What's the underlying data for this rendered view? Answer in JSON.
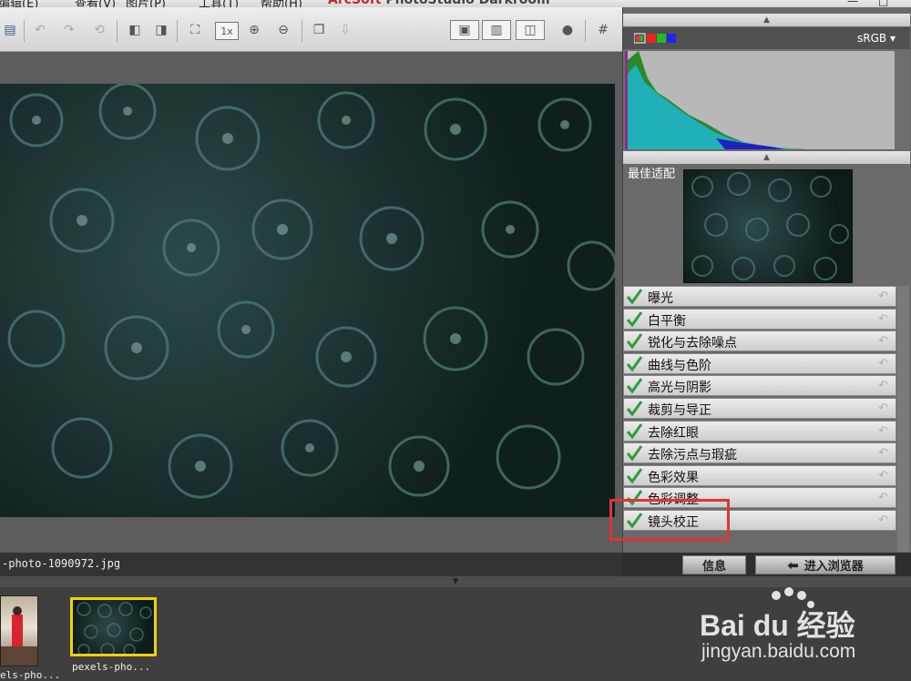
{
  "menu": {
    "items": [
      "编辑(E)",
      "查看(V)",
      "图片(P)",
      "工具(T)",
      "帮助(H)"
    ]
  },
  "app": {
    "title_brand": "ArcSoft",
    "title_rest": " PhotoStudio Darkroom"
  },
  "window_controls": {
    "minimize": "—",
    "maximize": "□"
  },
  "toolbar": {
    "zoom_1x": "1x"
  },
  "canvas": {
    "filename": "-photo-1090972.jpg"
  },
  "right_panel": {
    "color_space": "sRGB",
    "best_fit_label": "最佳适配",
    "tools": [
      {
        "label": "曝光"
      },
      {
        "label": "白平衡"
      },
      {
        "label": "锐化与去除噪点"
      },
      {
        "label": "曲线与色阶"
      },
      {
        "label": "高光与阴影"
      },
      {
        "label": "裁剪与导正"
      },
      {
        "label": "去除红眼"
      },
      {
        "label": "去除污点与瑕疵"
      },
      {
        "label": "色彩效果"
      },
      {
        "label": "色彩调整"
      },
      {
        "label": "镜头校正"
      }
    ],
    "info_button": "信息",
    "browse_button": "进入浏览器"
  },
  "filmstrip": {
    "items": [
      {
        "caption": "els-pho..."
      },
      {
        "caption": "pexels-pho..."
      }
    ]
  },
  "watermark": {
    "logo_text": "Bai du 经验",
    "url": "jingyan.baidu.com"
  },
  "colors": {
    "highlight": "#e23333",
    "selected_border": "#f2d100",
    "check": "#2e9e3a"
  }
}
